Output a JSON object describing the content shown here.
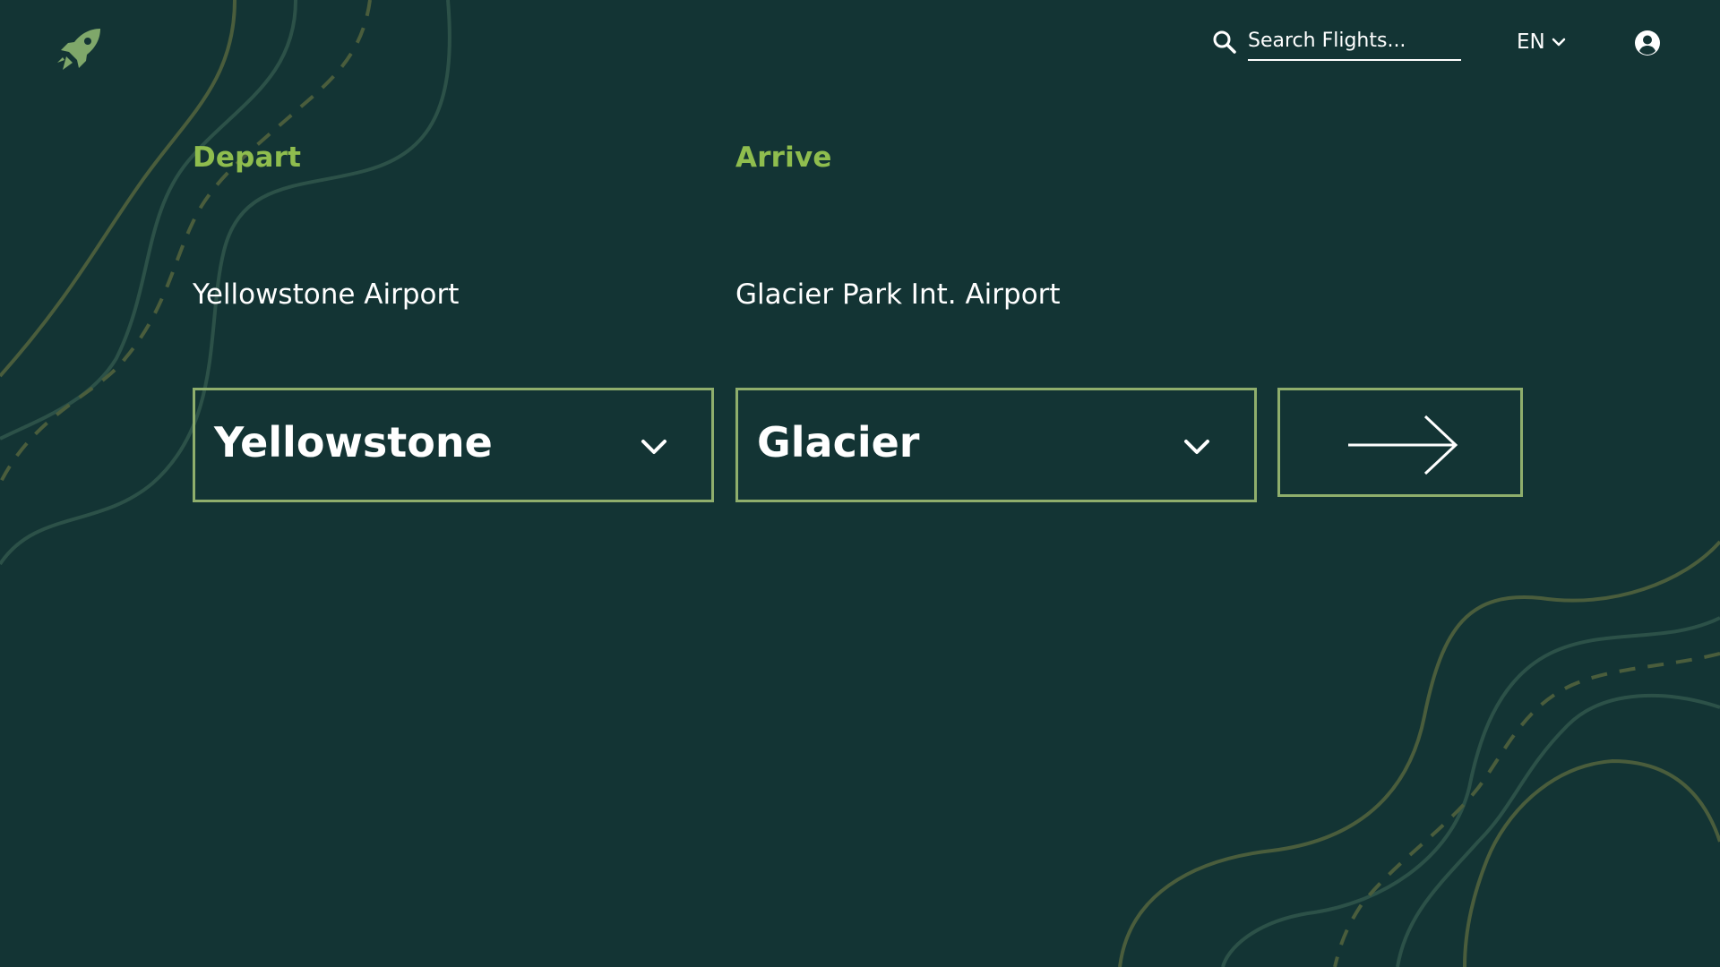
{
  "header": {
    "logo_icon": "rocket-icon",
    "search": {
      "placeholder": "Search Flights...",
      "icon": "search-icon"
    },
    "language": {
      "label": "EN",
      "icon": "chevron-down-icon"
    },
    "account_icon": "user-circle-icon"
  },
  "depart": {
    "label": "Depart",
    "airport_name": "Yellowstone Airport",
    "select_value": "Yellowstone"
  },
  "arrive": {
    "label": "Arrive",
    "airport_name": "Glacier Park Int. Airport",
    "select_value": "Glacier"
  },
  "submit": {
    "icon": "arrow-right-icon"
  },
  "colors": {
    "background": "#133434",
    "accent_label": "#8fbd4e",
    "border": "#8fae6c",
    "text": "#ffffff",
    "topo_olive": "#4a5d3c",
    "topo_teal": "#2c5148"
  }
}
